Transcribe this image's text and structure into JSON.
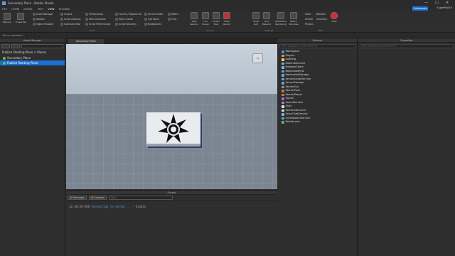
{
  "window": {
    "title": "Secondary Place - Roblox Studio",
    "controls": [
      "—",
      "□",
      "✕"
    ]
  },
  "menu": {
    "items": [
      "FILE",
      "HOME",
      "MODEL",
      "TEST",
      "VIEW",
      "PLUGINS"
    ],
    "active_index": 4
  },
  "topright": {
    "collaborate": "Collaborate",
    "user": "SuperPilot19"
  },
  "ribbon": {
    "explorer": "Explorer",
    "properties": "Properties",
    "col1": [
      "Asset Manager",
      "Toolbox",
      "Object Browser"
    ],
    "col2": [
      "Output",
      "Script Analysis",
      "Command Bar"
    ],
    "col3": [
      "Performance",
      "Task Scheduler",
      "Script Performance"
    ],
    "col4": [
      "Find All / Replace All",
      "Team Create",
      "Script Recovery"
    ],
    "col5": [
      "Terrain Editor",
      "Call Stack",
      "Breakpoints"
    ],
    "col6": [
      "Watch",
      "Chat"
    ],
    "show_label": "Show",
    "actions": [
      "View Selector",
      "Full Screen",
      "Screen Shot",
      "Video Record"
    ],
    "actions_label": "Actions",
    "settings": [
      "Show Grid",
      "Grid Material",
      "Wireframe Rendering",
      "Switch Windows"
    ],
    "settings_label": "Settings",
    "stats": [
      "Stats",
      "Render",
      "Physics",
      "Network",
      "Summary"
    ],
    "clear": "Clear",
    "stats_label": "Stats"
  },
  "runbar": "Run a command",
  "asset_manager": {
    "title": "Asset Manager",
    "crumb": "Publish Starting Place  >  Places",
    "places": [
      "Secondary Place",
      "Publish Starting Place"
    ],
    "selected_index": 1
  },
  "viewport": {
    "tab": "Secondary Place",
    "cube_label": "Top"
  },
  "output": {
    "title": "Output",
    "messages_filter": "All Messages",
    "contexts_filter": "All Contexts",
    "filter_placeholder": "Filter...",
    "log_time": "12:38:39.948",
    "log_text": "Connecting to server...",
    "log_source": "- Studio"
  },
  "explorer": {
    "title": "Explorer",
    "filter_placeholder": "Filter workspace (Ctrl+Shift+X)",
    "items": [
      {
        "name": "Workspace",
        "color": "#4a90e2"
      },
      {
        "name": "Players",
        "color": "#e0a040"
      },
      {
        "name": "Lighting",
        "color": "#f0d050"
      },
      {
        "name": "MaterialService",
        "color": "#7fb3e0"
      },
      {
        "name": "NetworkClient",
        "color": "#7fb3e0"
      },
      {
        "name": "ReplicatedFirst",
        "color": "#5fb0d0"
      },
      {
        "name": "ReplicatedStorage",
        "color": "#5fb0d0"
      },
      {
        "name": "ServerScriptService",
        "color": "#6fa0e0"
      },
      {
        "name": "ServerStorage",
        "color": "#6fa0e0"
      },
      {
        "name": "StarterGui",
        "color": "#60b060"
      },
      {
        "name": "StarterPack",
        "color": "#c08040"
      },
      {
        "name": "StarterPlayer",
        "color": "#c08040"
      },
      {
        "name": "Teams",
        "color": "#c060c0"
      },
      {
        "name": "SoundService",
        "color": "#9090e0"
      },
      {
        "name": "Chat",
        "color": "#e0e0e0"
      },
      {
        "name": "TextChatService",
        "color": "#e0e0e0"
      },
      {
        "name": "VoiceChatService",
        "color": "#7fb3e0"
      },
      {
        "name": "LocalizationService",
        "color": "#5fb0d0"
      },
      {
        "name": "TestService",
        "color": "#60b060"
      }
    ]
  },
  "properties": {
    "title": "Properties",
    "filter_placeholder": "Filter Properties (Ctrl+Shift+P)"
  }
}
